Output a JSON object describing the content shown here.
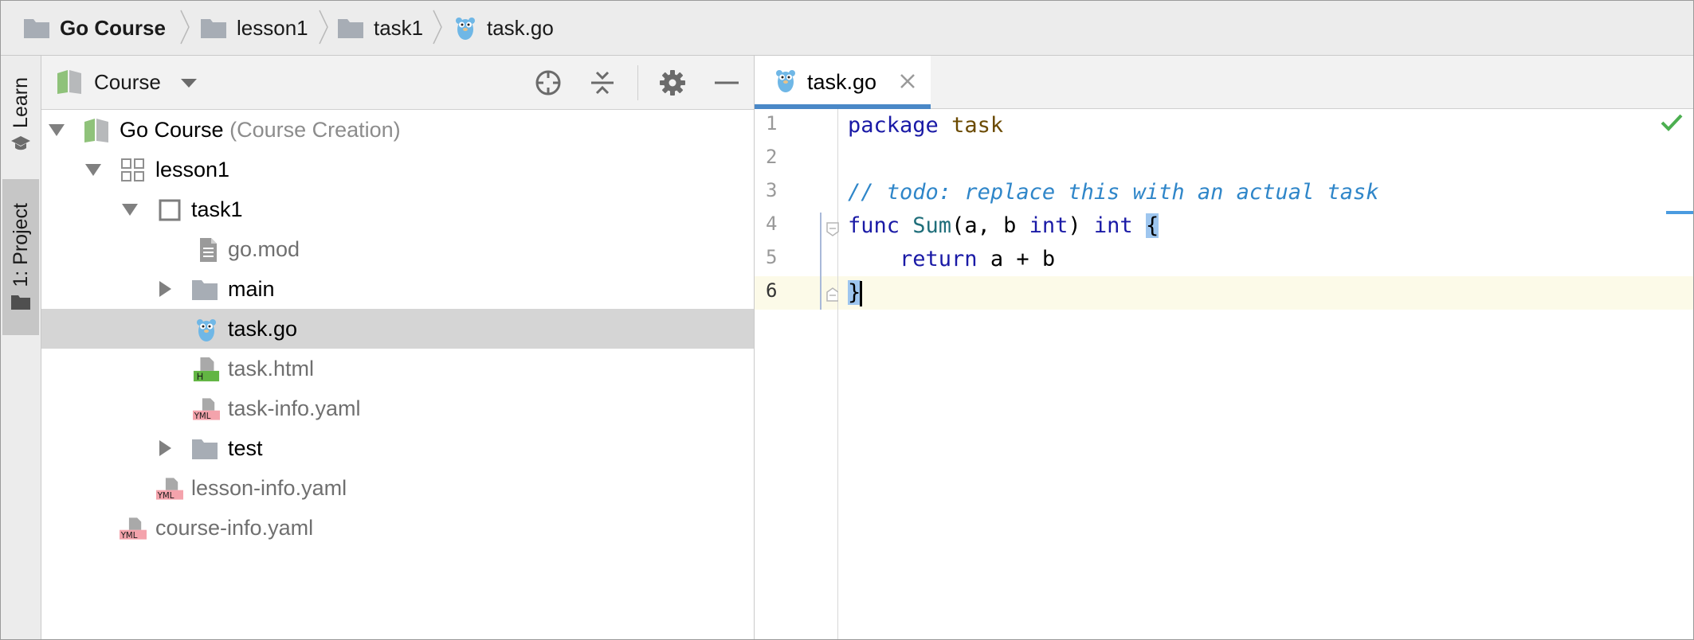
{
  "breadcrumbs": [
    {
      "label": "Go Course",
      "icon": "folder-icon",
      "bold": true
    },
    {
      "label": "lesson1",
      "icon": "folder-icon",
      "bold": false
    },
    {
      "label": "task1",
      "icon": "folder-icon",
      "bold": false
    },
    {
      "label": "task.go",
      "icon": "gopher-file-icon",
      "bold": false
    }
  ],
  "side_tabs": {
    "learn": "Learn",
    "project": "1: Project"
  },
  "project_panel": {
    "view_label": "Course",
    "tree": [
      {
        "label": "Go Course",
        "hint": "(Course Creation)",
        "icon": "course-icon",
        "expanded": true
      },
      {
        "label": "lesson1",
        "icon": "lesson-icon",
        "expanded": true
      },
      {
        "label": "task1",
        "icon": "task-icon",
        "expanded": true
      },
      {
        "label": "go.mod",
        "icon": "text-file-icon"
      },
      {
        "label": "main",
        "icon": "folder-icon",
        "expanded": false
      },
      {
        "label": "task.go",
        "icon": "gopher-file-icon",
        "selected": true
      },
      {
        "label": "task.html",
        "icon": "html-file-icon"
      },
      {
        "label": "task-info.yaml",
        "icon": "yaml-file-icon"
      },
      {
        "label": "test",
        "icon": "folder-icon",
        "expanded": false
      },
      {
        "label": "lesson-info.yaml",
        "icon": "yaml-file-icon"
      },
      {
        "label": "course-info.yaml",
        "icon": "yaml-file-icon"
      }
    ]
  },
  "editor": {
    "tab_label": "task.go",
    "line_numbers": [
      "1",
      "2",
      "3",
      "4",
      "5",
      "6"
    ],
    "code": {
      "l1_kw": "package",
      "l1_name": "task",
      "l3_slashes": "// ",
      "l3_comment": "todo: replace this with an actual task",
      "l4_func": "func",
      "l4_name": "Sum",
      "l4_params_a": "(a, b ",
      "l4_int1": "int",
      "l4_close": ") ",
      "l4_int2": "int",
      "l4_brace": "{",
      "l5_indent": "    ",
      "l5_return": "return",
      "l5_expr": " a + b",
      "l6_brace": "}"
    },
    "current_line": 6
  },
  "colors": {
    "accent": "#4a88c7",
    "selection": "#d5d5d5",
    "current_line": "#fcfae8",
    "keyword": "#1a1aa6",
    "comment": "#2f86c9"
  }
}
